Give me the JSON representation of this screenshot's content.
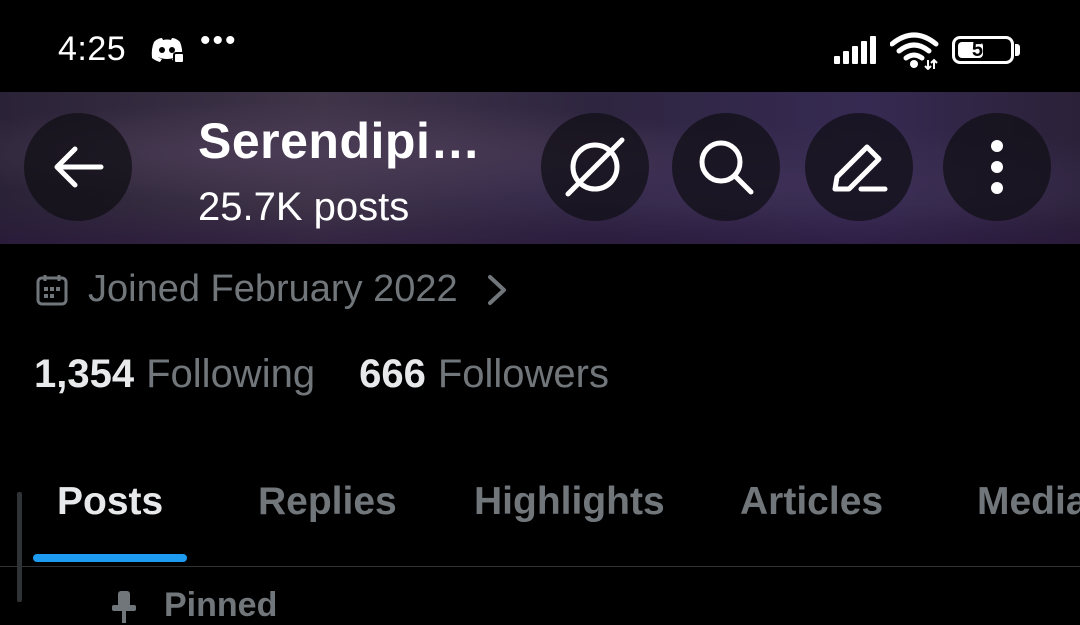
{
  "status": {
    "time": "4:25",
    "dots": "•••",
    "battery": "50",
    "battery_level": 0.5
  },
  "header": {
    "title": "Serendipi…",
    "posts_count": "25.7K posts"
  },
  "profile": {
    "joined": "Joined February 2022",
    "following_count": "1,354",
    "following_label": "Following",
    "followers_count": "666",
    "followers_label": "Followers"
  },
  "tabs": [
    {
      "label": "Posts"
    },
    {
      "label": "Replies"
    },
    {
      "label": "Highlights"
    },
    {
      "label": "Articles"
    },
    {
      "label": "Media"
    }
  ],
  "pinned": {
    "label": "Pinned"
  },
  "colors": {
    "accent": "#1d9bf0",
    "secondary_text": "#71767b",
    "background": "#000000"
  }
}
